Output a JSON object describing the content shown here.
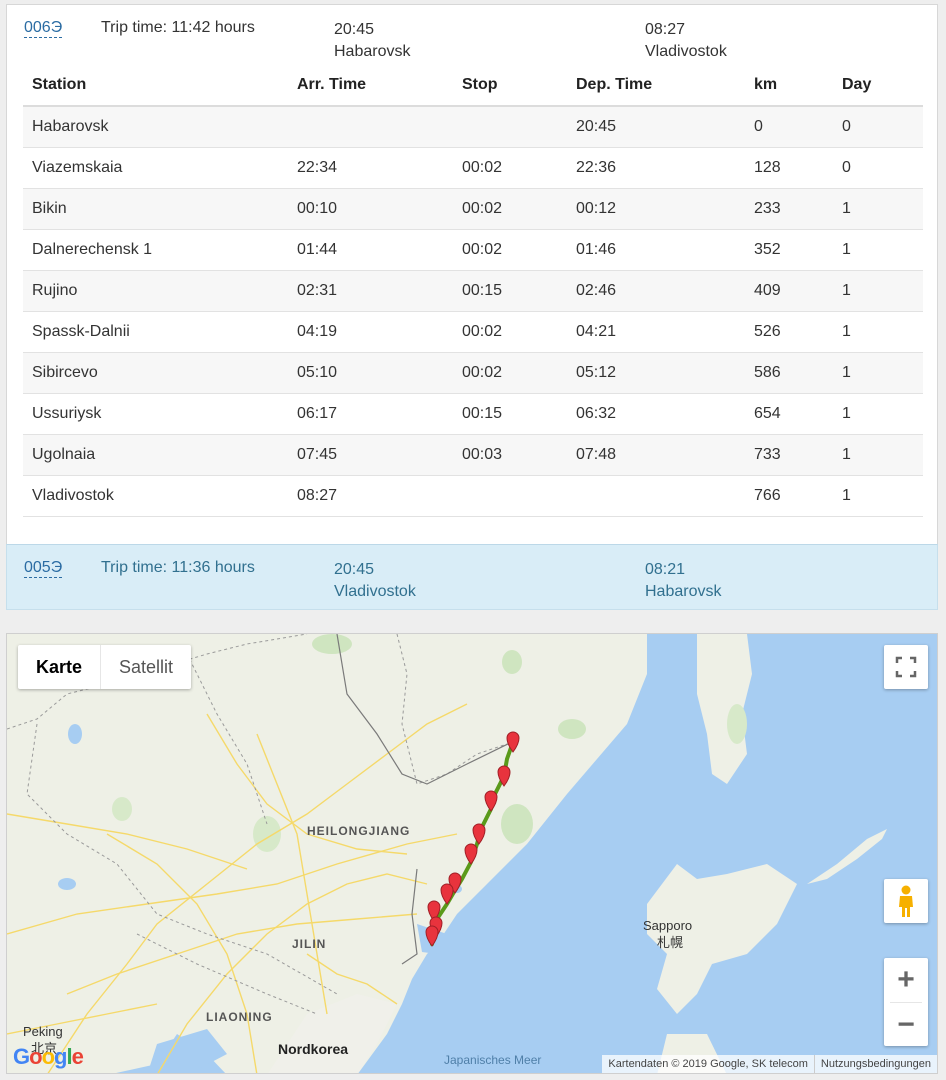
{
  "trip1": {
    "id": "006Э",
    "trip_time": "Trip time: 11:42 hours",
    "dep_time": "20:45",
    "dep_station": "Habarovsk",
    "arr_time": "08:27",
    "arr_station": "Vladivostok"
  },
  "table": {
    "headers": [
      "Station",
      "Arr. Time",
      "Stop",
      "Dep. Time",
      "km",
      "Day"
    ],
    "rows": [
      [
        "Habarovsk",
        "",
        "",
        "20:45",
        "0",
        "0"
      ],
      [
        "Viazemskaia",
        "22:34",
        "00:02",
        "22:36",
        "128",
        "0"
      ],
      [
        "Bikin",
        "00:10",
        "00:02",
        "00:12",
        "233",
        "1"
      ],
      [
        "Dalnerechensk 1",
        "01:44",
        "00:02",
        "01:46",
        "352",
        "1"
      ],
      [
        "Rujino",
        "02:31",
        "00:15",
        "02:46",
        "409",
        "1"
      ],
      [
        "Spassk-Dalnii",
        "04:19",
        "00:02",
        "04:21",
        "526",
        "1"
      ],
      [
        "Sibircevo",
        "05:10",
        "00:02",
        "05:12",
        "586",
        "1"
      ],
      [
        "Ussuriysk",
        "06:17",
        "00:15",
        "06:32",
        "654",
        "1"
      ],
      [
        "Ugolnaia",
        "07:45",
        "00:03",
        "07:48",
        "733",
        "1"
      ],
      [
        "Vladivostok",
        "08:27",
        "",
        "",
        "766",
        "1"
      ]
    ]
  },
  "trip2": {
    "id": "005Э",
    "trip_time": "Trip time: 11:36 hours",
    "dep_time": "20:45",
    "dep_station": "Vladivostok",
    "arr_time": "08:21",
    "arr_station": "Habarovsk"
  },
  "map": {
    "type_map": "Karte",
    "type_satellite": "Satellit",
    "labels": {
      "heilongjiang": "HEILONGJIANG",
      "jilin": "JILIN",
      "liaoning": "LIAONING",
      "sapporo": "Sapporo",
      "sapporo_cjk": "札幌",
      "peking": "Peking",
      "peking_cjk": "北京",
      "nordkorea": "Nordkorea",
      "japanisches_meer": "Japanisches Meer"
    },
    "logo": "Google",
    "attribution": "Kartendaten © 2019 Google, SK telecom",
    "terms": "Nutzungsbedingungen",
    "zoom_in": "+",
    "zoom_out": "−",
    "route_color": "#5a9a1a",
    "marker_color": "#e8333d",
    "water_color": "#a7cdf2",
    "land_color": "#eef0e6"
  }
}
